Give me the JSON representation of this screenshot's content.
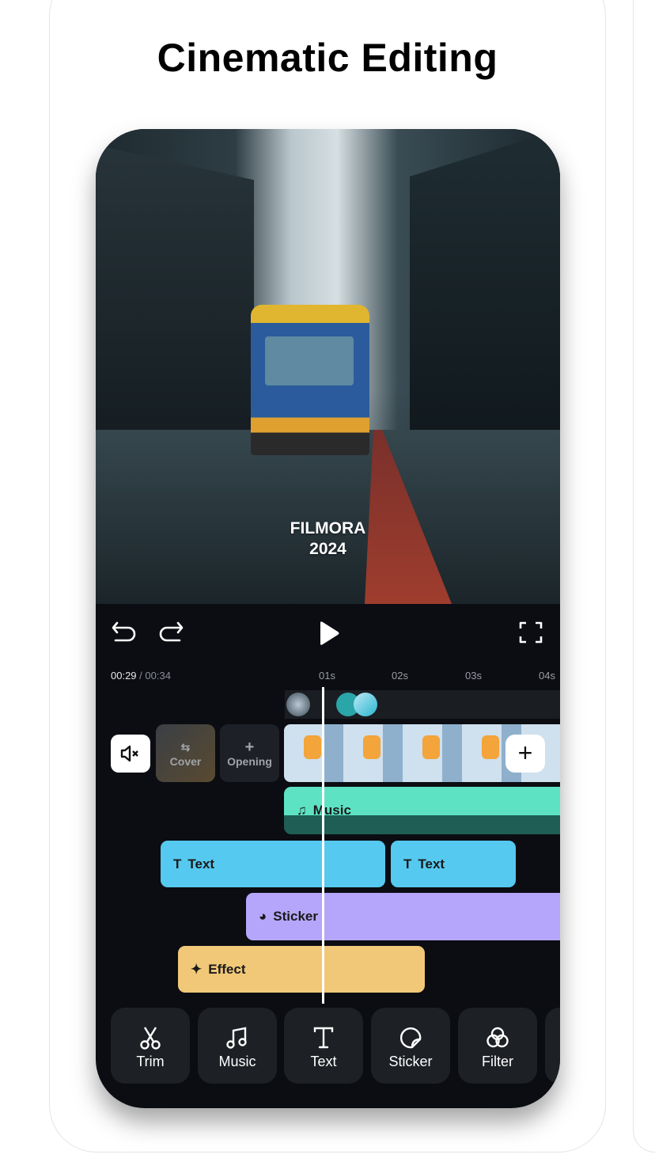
{
  "heading": "Cinematic Editing",
  "preview": {
    "watermark_line1": "FILMORA",
    "watermark_line2": "2024"
  },
  "controls": {
    "undo": "undo-icon",
    "redo": "redo-icon",
    "play": "play-icon",
    "fullscreen": "fullscreen-icon"
  },
  "timeline": {
    "current": "00:29",
    "separator": " / ",
    "total": "00:34",
    "ticks": [
      "01s",
      "02s",
      "03s",
      "04s"
    ]
  },
  "tracks": {
    "cover": "Cover",
    "opening": "Opening",
    "music": "Music",
    "text1": "Text",
    "text2": "Text",
    "sticker": "Sticker",
    "effect": "Effect"
  },
  "colors": {
    "music": "#5de3c4",
    "text": "#56c9f0",
    "sticker": "#b5a6fb",
    "effect": "#f1c878"
  },
  "toolbar": [
    {
      "label": "Trim",
      "icon": "scissors-icon"
    },
    {
      "label": "Music",
      "icon": "music-note-icon"
    },
    {
      "label": "Text",
      "icon": "text-icon"
    },
    {
      "label": "Sticker",
      "icon": "sticker-icon"
    },
    {
      "label": "Filter",
      "icon": "filter-icon"
    }
  ]
}
